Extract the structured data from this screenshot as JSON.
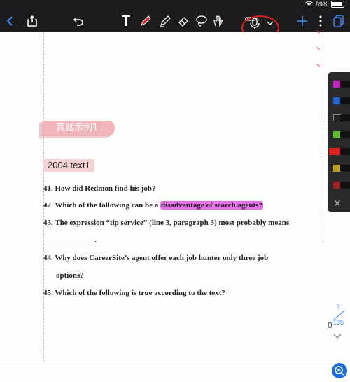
{
  "status": {
    "battery_percent": "89%"
  },
  "toolbar": {
    "recording_time": "00:04"
  },
  "section": {
    "badge": "真题示例1",
    "text_label": "2004 text1"
  },
  "questions": [
    {
      "num": "41.",
      "text": "How did Redmon find his job?"
    },
    {
      "num": "42.",
      "pre": "Which of the following can be a ",
      "highlight": "disadvantage of search agents?"
    },
    {
      "num": "43.",
      "text": "The expression “tip service” (line 3, paragraph 3) most probably means"
    },
    {
      "blank": "__________."
    },
    {
      "num": "44.",
      "text": "Why does CareerSite’s agent offer each job hunter only three job"
    },
    {
      "cont": "options?"
    },
    {
      "num": "45.",
      "text": "Which of the following is true according to the text?"
    }
  ],
  "pages": {
    "current": "7",
    "total": "135",
    "counter": "0"
  },
  "palette_colors": [
    "#c020c0",
    "#2060d0",
    "#222222",
    "#60c030",
    "#e02020",
    "#c0a020",
    "#a02020"
  ],
  "annotation_color": "#e870e8",
  "accent": "#1a6ed8"
}
